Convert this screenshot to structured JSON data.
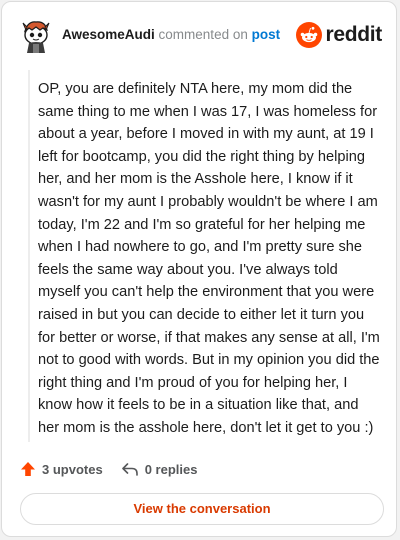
{
  "header": {
    "username": "AwesomeAudi",
    "commented_text": "commented on",
    "post_link": "post",
    "brand": "reddit"
  },
  "comment": {
    "text": "OP, you are definitely NTA here, my mom did the same thing to me when I was 17, I was homeless for about a year, before I moved in with my aunt, at 19 I left for bootcamp, you did the right thing by helping her, and her mom is the Asshole here, I know if it wasn't for my aunt I probably wouldn't be where I am today, I'm 22 and I'm so grateful for her helping me when I had nowhere to go, and I'm pretty sure she feels the same way about you. I've always told myself you can't help the environment that you were raised in but you can decide to either let it turn you for better or worse, if that makes any sense at all, I'm not to good with words. But in my opinion you did the right thing and I'm proud of you for helping her, I know how it feels to be in a situation like that, and her mom is the asshole here, don't let it get to you :)"
  },
  "actions": {
    "upvotes": "3 upvotes",
    "replies": "0 replies"
  },
  "button": {
    "view_conversation": "View the conversation"
  },
  "colors": {
    "brand_orange": "#ff4500",
    "link_blue": "#0079d3",
    "button_text": "#d93a00"
  },
  "icons": {
    "avatar": "snoo-avatar-icon",
    "brand": "reddit-logo-icon",
    "upvote": "upvote-arrow-icon",
    "reply": "reply-arrow-icon"
  }
}
